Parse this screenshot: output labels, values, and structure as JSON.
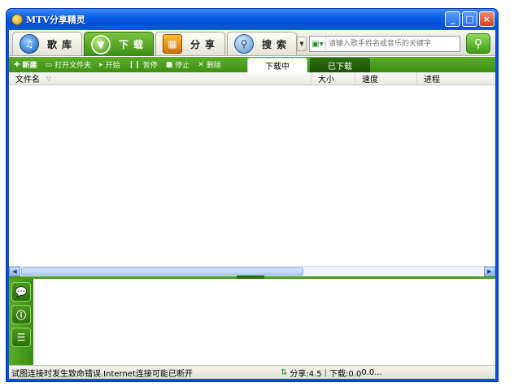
{
  "window": {
    "title": "MTV分享精灵",
    "minimize_label": "_",
    "maximize_label": "□",
    "close_label": "×"
  },
  "tabs": [
    {
      "label": "歌库",
      "icon": "music-library-icon",
      "active": false
    },
    {
      "label": "下载",
      "icon": "download-icon",
      "active": true
    },
    {
      "label": "分享",
      "icon": "share-icon",
      "active": false
    },
    {
      "label": "搜索",
      "icon": "search-icon",
      "active": false
    }
  ],
  "search": {
    "placeholder": "请输入歌手姓名或音乐的关键字",
    "dropdown_glyph": "▼",
    "go_glyph": "🔍"
  },
  "toolbar": {
    "new_label": "新建",
    "open_folder_label": "打开文件夹",
    "start_label": "开始",
    "pause_label": "暂停",
    "stop_label": "停止",
    "delete_label": "删除"
  },
  "subtabs": {
    "downloading_label": "下载中",
    "downloaded_label": "已下载"
  },
  "columns": {
    "name": "文件名",
    "size": "大小",
    "speed": "速度",
    "progress": "进程"
  },
  "status": {
    "message": "试图连接时发生致命错误.Internet连接可能已断开",
    "share_label": "分享:4.5",
    "separator": "|",
    "download_label": "下载:0.0",
    "trailing": "0.0..."
  },
  "colors": {
    "accent_green": "#3e8e14",
    "title_blue": "#0a50d8"
  }
}
